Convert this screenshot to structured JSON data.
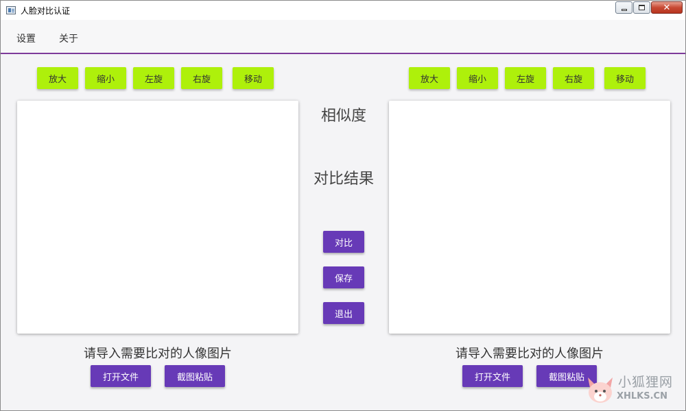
{
  "window": {
    "title": "人脸对比认证"
  },
  "menu": {
    "items": [
      "设置",
      "关于"
    ]
  },
  "left_tools": [
    "放大",
    "缩小",
    "左旋",
    "右旋",
    "移动"
  ],
  "right_tools": [
    "放大",
    "缩小",
    "左旋",
    "右旋",
    "移动"
  ],
  "center": {
    "similarity_label": "相似度",
    "result_label": "对比结果",
    "compare_button": "对比",
    "save_button": "保存",
    "exit_button": "退出"
  },
  "left_panel": {
    "prompt": "请导入需要比对的人像图片",
    "open_file_button": "打开文件",
    "screenshot_paste_button": "截图粘贴"
  },
  "right_panel": {
    "prompt": "请导入需要比对的人像图片",
    "open_file_button": "打开文件",
    "screenshot_paste_button": "截图粘贴"
  },
  "watermark": {
    "cn": "小狐狸网",
    "en": "XHLKS.CN"
  },
  "colors": {
    "tool_button": "#aef00b",
    "action_button": "#673ab7",
    "menu_underline": "#7d3a9a"
  }
}
